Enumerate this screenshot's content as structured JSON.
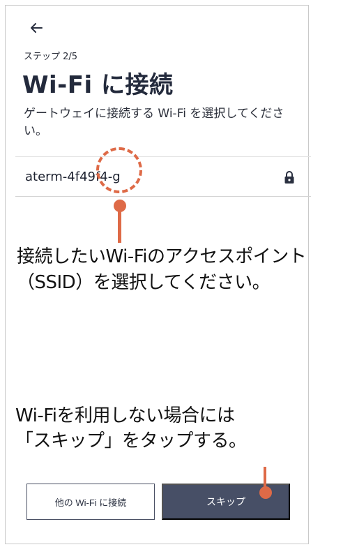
{
  "header": {
    "back_icon": "arrow-left-icon",
    "step": "ステップ 2/5",
    "title": "Wi-Fi に接続",
    "description": "ゲートウェイに接続する Wi-Fi を選択してください。"
  },
  "network": {
    "ssid": "aterm-4f49f4-g",
    "lock_icon": "lock-icon"
  },
  "annotations": {
    "select_line1": "接続したいWi-Fiのアクセスポイント",
    "select_line2": "（SSID）を選択してください。",
    "skip_line1": "Wi-Fiを利用しない場合には",
    "skip_line2": "「スキップ」をタップする。",
    "accent_color": "#de6a47"
  },
  "buttons": {
    "other_wifi": "他の Wi-Fi に接続",
    "skip": "スキップ"
  }
}
